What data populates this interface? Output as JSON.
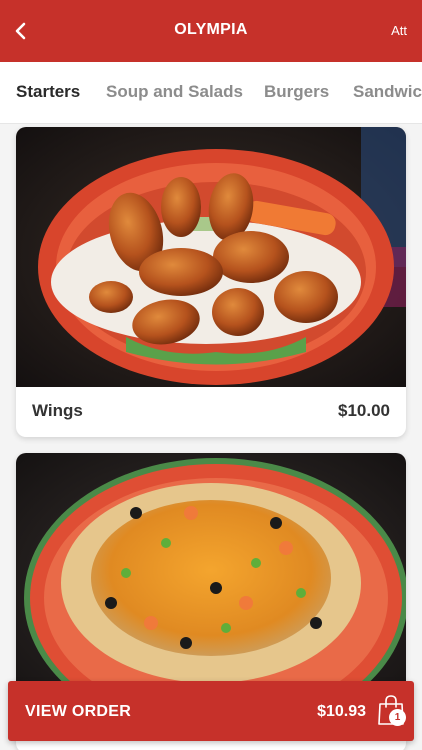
{
  "header": {
    "title": "OLYMPIA",
    "right_label": "Att",
    "color": "#c6312a"
  },
  "tabs": [
    {
      "label": "Starters",
      "active": true
    },
    {
      "label": "Soup and Salads",
      "active": false
    },
    {
      "label": "Burgers",
      "active": false
    },
    {
      "label": "Sandwich",
      "active": false
    }
  ],
  "items": [
    {
      "name": "Wings",
      "price": "$10.00",
      "image": "wings-photo"
    },
    {
      "name": "",
      "price": "",
      "image": "nachos-photo"
    }
  ],
  "order_bar": {
    "label": "VIEW ORDER",
    "total": "$10.93",
    "count": "1",
    "icon": "shopping-bag-icon"
  }
}
